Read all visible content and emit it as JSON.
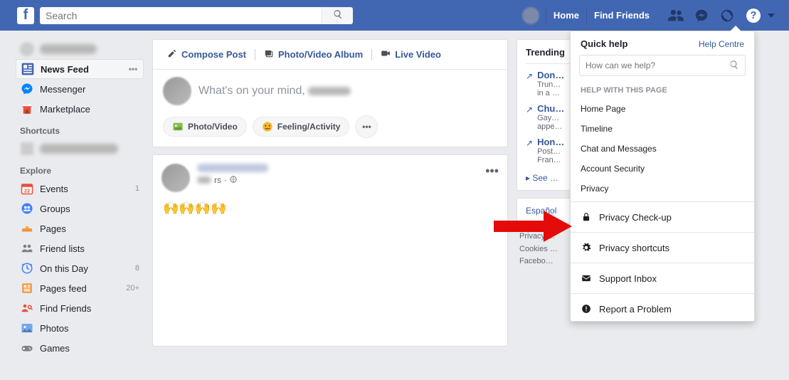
{
  "bluebar": {
    "search_placeholder": "Search",
    "links": {
      "home": "Home",
      "find_friends": "Find Friends"
    }
  },
  "leftnav": {
    "news_feed": "News Feed",
    "messenger": "Messenger",
    "marketplace": "Marketplace",
    "shortcuts_head": "Shortcuts",
    "explore_head": "Explore",
    "events": "Events",
    "events_badge": "1",
    "groups": "Groups",
    "pages": "Pages",
    "friend_lists": "Friend lists",
    "on_this_day": "On this Day",
    "on_this_day_badge": "8",
    "pages_feed": "Pages feed",
    "pages_feed_badge": "20+",
    "find_friends": "Find Friends",
    "photos": "Photos",
    "games": "Games",
    "events_day": "22"
  },
  "composer": {
    "tabs": {
      "compose": "Compose Post",
      "album": "Photo/Video Album",
      "live": "Live Video"
    },
    "placeholder": "What's on your mind, ",
    "actions": {
      "photo": "Photo/Video",
      "feeling": "Feeling/Activity"
    }
  },
  "post": {
    "meta_suffix": "rs",
    "body": "🙌🙌🙌🙌"
  },
  "trending": {
    "head": "Trending",
    "items": [
      {
        "title": "Don…",
        "sub": "Trun…",
        "sub2": "in a …"
      },
      {
        "title": "Chu…",
        "sub": "Gay…",
        "sub2": "appe…"
      },
      {
        "title": "Hon…",
        "sub": "Post…",
        "sub2": "Fran…"
      }
    ],
    "see_more": "See …"
  },
  "lang": {
    "espanol": "Español"
  },
  "footer": {
    "line1": "Privacy …",
    "line2": "Cookies …",
    "line3": "Facebo…"
  },
  "dropdown": {
    "title": "Quick help",
    "help_centre": "Help Centre",
    "search_placeholder": "How can we help?",
    "section_label": "HELP WITH THIS PAGE",
    "items": {
      "home_page": "Home Page",
      "timeline": "Timeline",
      "chat": "Chat and Messages",
      "security": "Account Security",
      "privacy": "Privacy"
    },
    "actions": {
      "privacy_checkup": "Privacy Check-up",
      "privacy_shortcuts": "Privacy shortcuts",
      "support_inbox": "Support Inbox",
      "report": "Report a Problem"
    }
  }
}
